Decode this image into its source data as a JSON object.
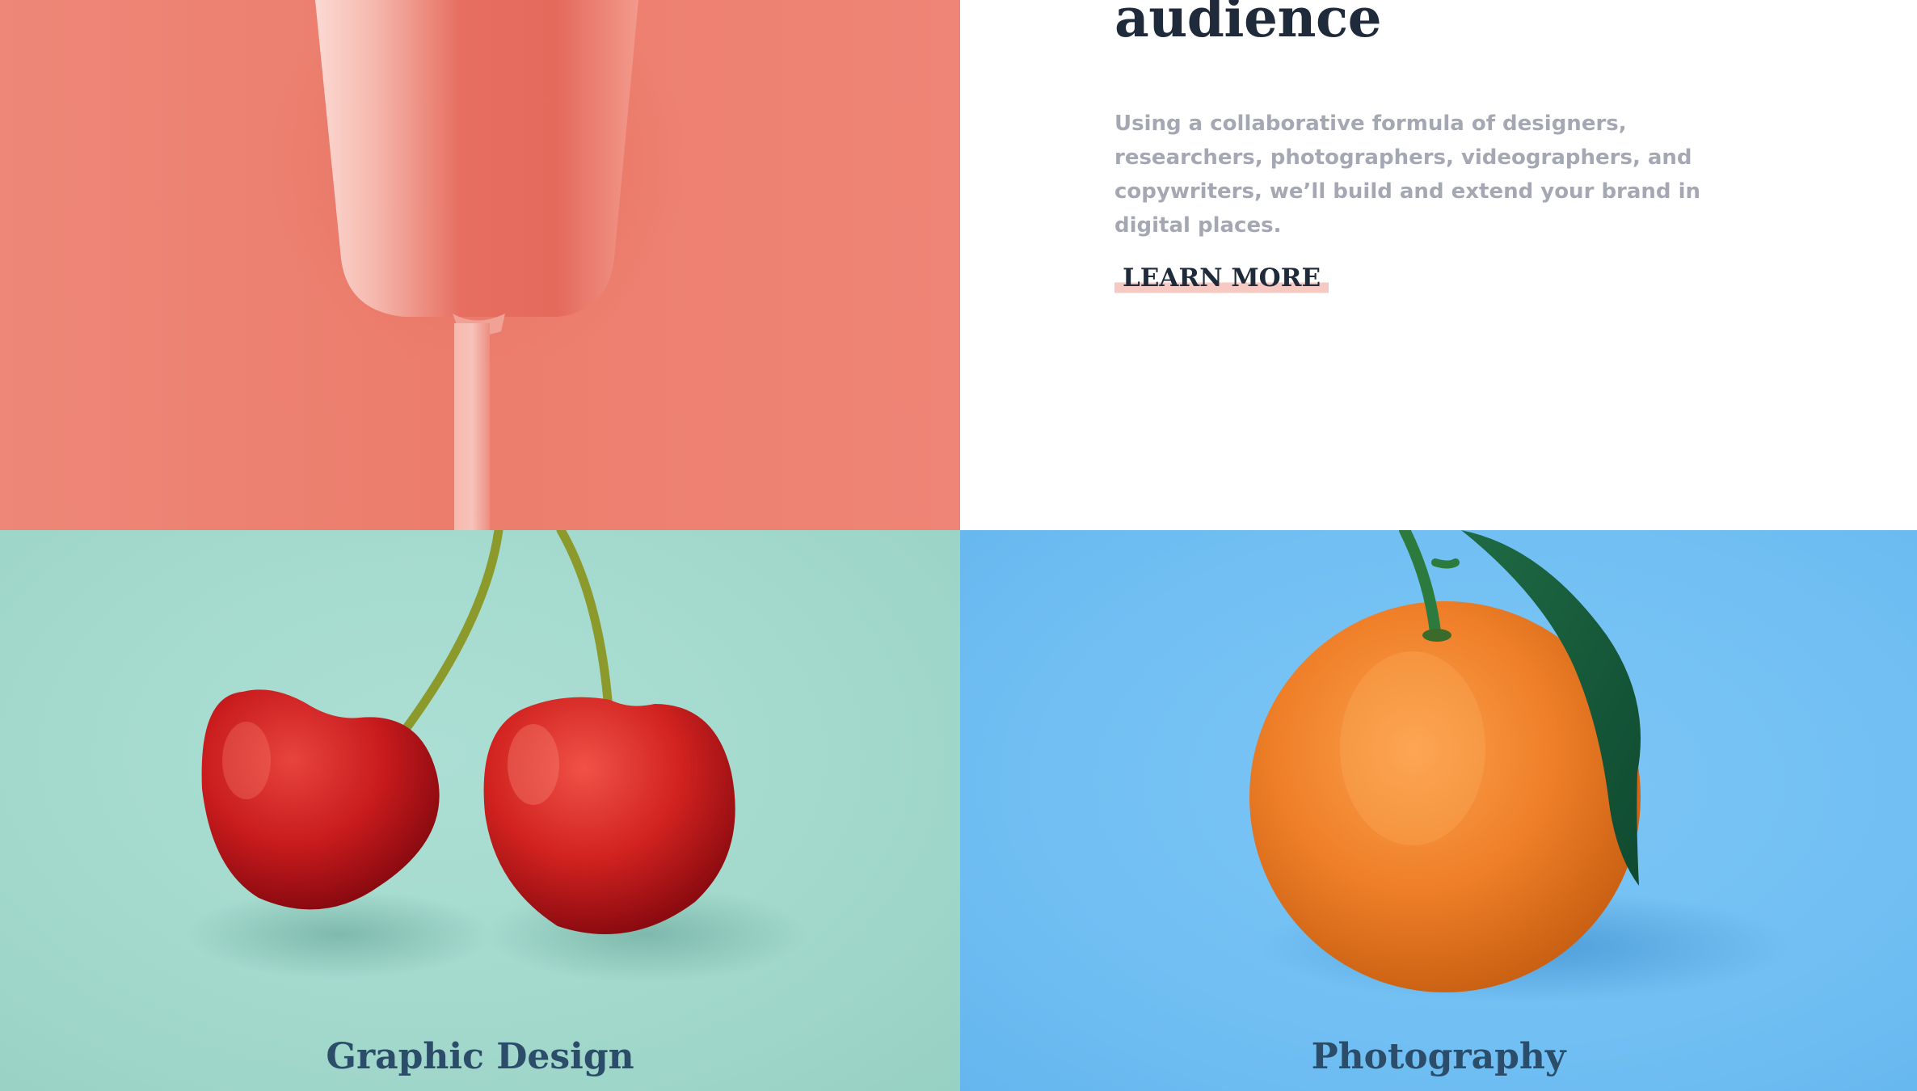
{
  "hero": {
    "headline_line_visible": "audience",
    "body": "Using a collaborative formula of designers, researchers, photographers, videographers, and copywriters, we’ll build and extend your brand in digital places.",
    "cta_label": "LEARN MORE"
  },
  "services": [
    {
      "label": "Graphic Design",
      "image": "cherries-photo"
    },
    {
      "label": "Photography",
      "image": "orange-photo"
    }
  ],
  "colors": {
    "headline": "#1f2a3a",
    "body_text": "#a3a8b3",
    "cta_highlight": "#f6c9c2",
    "service_label": "#2c4d6a",
    "glass_panel_bg": "#ec7d6c",
    "cherry_panel_bg": "#a3d9cd",
    "orange_panel_bg": "#71bff3"
  }
}
